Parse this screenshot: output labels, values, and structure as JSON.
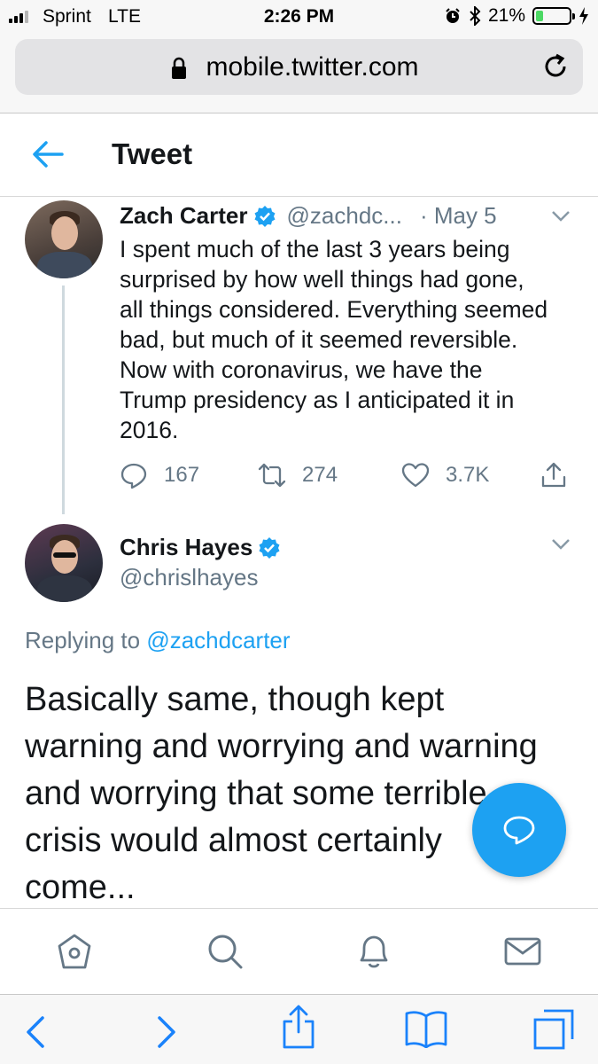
{
  "status_bar": {
    "carrier": "Sprint",
    "network": "LTE",
    "time": "2:26 PM",
    "battery_percent": "21%",
    "battery_level": 0.21
  },
  "browser": {
    "url": "mobile.twitter.com"
  },
  "header": {
    "title": "Tweet"
  },
  "parent_tweet": {
    "author_name": "Zach Carter",
    "handle": "@zachdc...",
    "date": "· May 5",
    "text": "I spent much of the last 3 years being\nsurprised by how well things had gone,\nall things considered. Everything seemed\nbad, but much of it seemed reversible.\nNow with coronavirus, we have the\nTrump presidency as I anticipated it in\n2016.",
    "replies": "167",
    "retweets": "274",
    "likes": "3.7K"
  },
  "main_tweet": {
    "author_name": "Chris Hayes",
    "handle": "@chrislhayes",
    "replying_label": "Replying to",
    "replying_to": "@zachdcarter",
    "text": "Basically same, though kept\nwarning and worrying and warning\nand worrying that some terrible\ncrisis would almost certainly\ncome..."
  },
  "colors": {
    "accent": "#1da1f2",
    "text_primary": "#14171a",
    "text_secondary": "#657786",
    "ios_blue": "#1a82fb",
    "battery_green": "#4cd964"
  },
  "icons": {
    "status": [
      "signal-icon",
      "alarm-icon",
      "bluetooth-icon",
      "battery-icon",
      "charging-icon"
    ],
    "browser": [
      "lock-icon",
      "reload-icon"
    ],
    "tweet_actions": [
      "reply-icon",
      "retweet-icon",
      "like-icon",
      "share-icon"
    ],
    "twitter_nav": [
      "home-icon",
      "search-icon",
      "notifications-icon",
      "messages-icon"
    ],
    "safari_toolbar": [
      "back-icon",
      "forward-icon",
      "share-icon",
      "bookmarks-icon",
      "tabs-icon"
    ]
  }
}
